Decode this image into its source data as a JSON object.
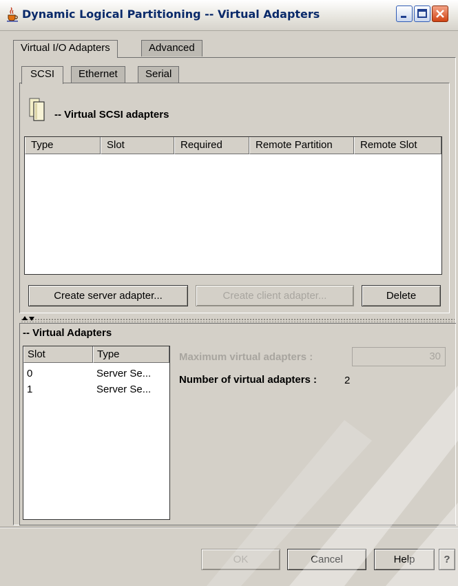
{
  "window": {
    "title": "Dynamic Logical Partitioning -- Virtual Adapters",
    "icon": "java-cup-icon"
  },
  "outer_tabs": [
    {
      "label": "Virtual I/O Adapters",
      "active": true
    },
    {
      "label": "Advanced",
      "active": false
    }
  ],
  "inner_tabs": [
    {
      "label": "SCSI",
      "active": true
    },
    {
      "label": "Ethernet",
      "active": false
    },
    {
      "label": "Serial",
      "active": false
    }
  ],
  "scsi_section": {
    "title": "-- Virtual SCSI adapters",
    "columns": [
      "Type",
      "Slot",
      "Required",
      "Remote Partition",
      "Remote Slot"
    ],
    "rows": []
  },
  "scsi_buttons": {
    "create_server": "Create server adapter...",
    "create_client": "Create client adapter...",
    "delete": "Delete"
  },
  "virtual_adapters": {
    "title": "-- Virtual Adapters",
    "columns": [
      "Slot",
      "Type"
    ],
    "rows": [
      {
        "slot": "0",
        "type": "Server Se..."
      },
      {
        "slot": "1",
        "type": "Server Se..."
      }
    ],
    "max_label": "Maximum virtual adapters :",
    "max_value": "30",
    "number_label": "Number of virtual adapters :",
    "number_value": "2"
  },
  "dialog_buttons": {
    "ok": "OK",
    "cancel": "Cancel",
    "help": "Help",
    "context_help": "?"
  }
}
